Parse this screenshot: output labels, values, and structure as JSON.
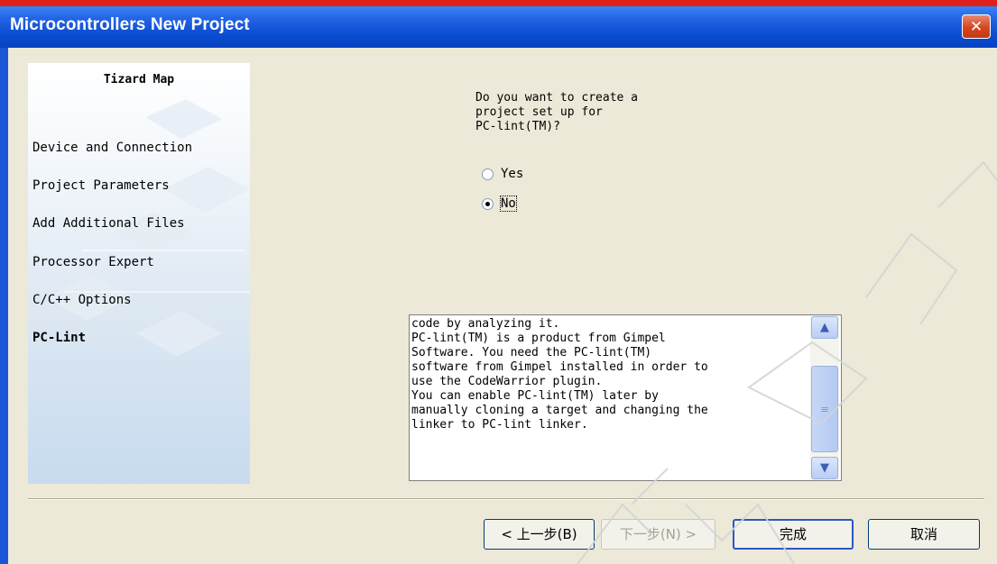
{
  "window": {
    "title": "Microcontrollers New Project",
    "close_symbol": "✕"
  },
  "wizard_map": {
    "heading": "Tizard Map",
    "items": [
      {
        "label": "Device and Connection",
        "active": false
      },
      {
        "label": "Project Parameters",
        "active": false
      },
      {
        "label": "Add Additional Files",
        "active": false
      },
      {
        "label": "Processor Expert",
        "active": false
      },
      {
        "label": "C/C++ Options",
        "active": false
      },
      {
        "label": "PC-Lint",
        "active": true
      }
    ]
  },
  "question": {
    "text": "Do you want to create a\nproject set up for\nPC-lint(TM)?"
  },
  "options": {
    "yes_label": "Yes",
    "no_label": "No",
    "selected": "No"
  },
  "description": {
    "text": "code by analyzing it.\nPC-lint(TM) is a product from Gimpel\nSoftware. You need the PC-lint(TM)\nsoftware from Gimpel installed in order to\nuse the CodeWarrior plugin.\nYou can enable PC-lint(TM) later by\nmanually cloning a target and changing the\nlinker to PC-lint linker.",
    "scroll_up_icon": "chevron-up-icon",
    "scroll_down_icon": "chevron-down-icon"
  },
  "buttons": {
    "back": "< 上一步(B)",
    "next": "下一步(N) >",
    "finish": "完成",
    "cancel": "取消"
  },
  "colors": {
    "title_bar": "#0a4cd0",
    "dialog_face": "#ece9d8",
    "close_button": "#d8451e"
  }
}
